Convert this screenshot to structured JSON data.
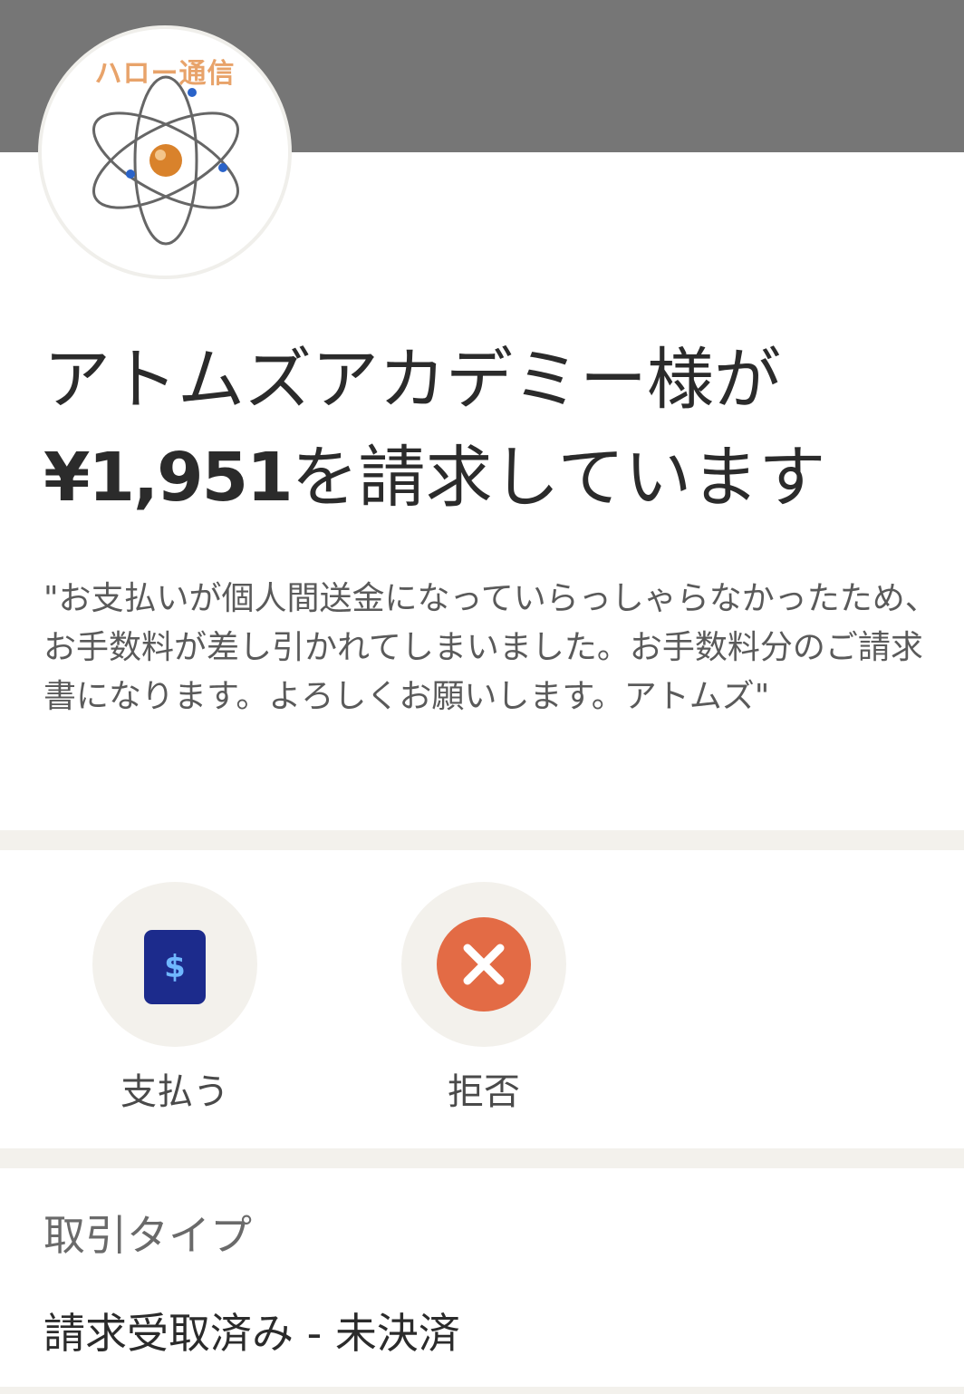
{
  "header": {
    "avatar_text": "ハロー通信",
    "avatar_icon": "atom-icon"
  },
  "request": {
    "title_line1": "アトムズアカデミー様が",
    "amount": "¥1,951",
    "title_line2_suffix": "を請求しています",
    "note": "\"お支払いが個人間送金になっていらっしゃらなかったため、お手数料が差し引かれてしまいました。お手数料分のご請求書になります。よろしくお願いします。アトムズ\""
  },
  "actions": {
    "pay_label": "支払う",
    "pay_icon_glyph": "$",
    "decline_label": "拒否"
  },
  "details": {
    "type_label": "取引タイプ",
    "type_value": "請求受取済み - 未決済"
  },
  "colors": {
    "header_band": "#767676",
    "pay_icon_bg": "#1c2b8c",
    "pay_icon_fg": "#6fb7ff",
    "decline_icon_bg": "#e36b45",
    "divider": "#f3f1ec"
  }
}
